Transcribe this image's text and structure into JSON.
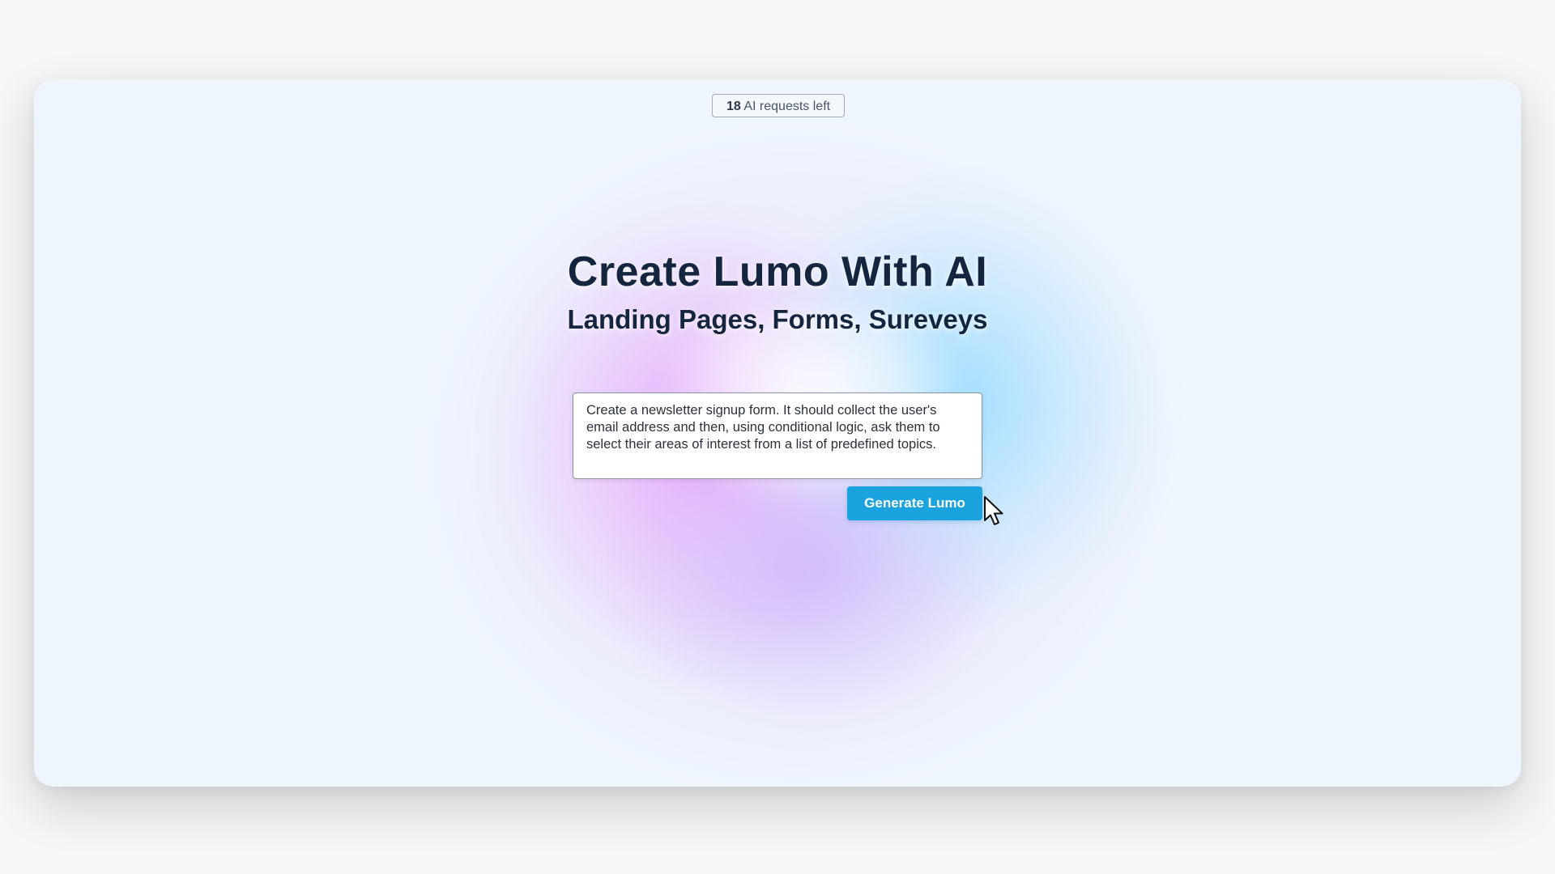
{
  "requests": {
    "count": "18",
    "label": " AI requests left"
  },
  "hero": {
    "title": "Create Lumo With AI",
    "subtitle": "Landing Pages, Forms, Sureveys"
  },
  "prompt": {
    "value": "Create a newsletter signup form. It should collect the user's email address and then, using conditional logic, ask them to select their areas of interest from a list of predefined topics."
  },
  "actions": {
    "generate_label": "Generate Lumo"
  },
  "colors": {
    "accent": "#1aa3df",
    "heading": "#14263d",
    "background": "#eff5fd"
  },
  "icons": {
    "pointer": "mouse-pointer-icon"
  }
}
